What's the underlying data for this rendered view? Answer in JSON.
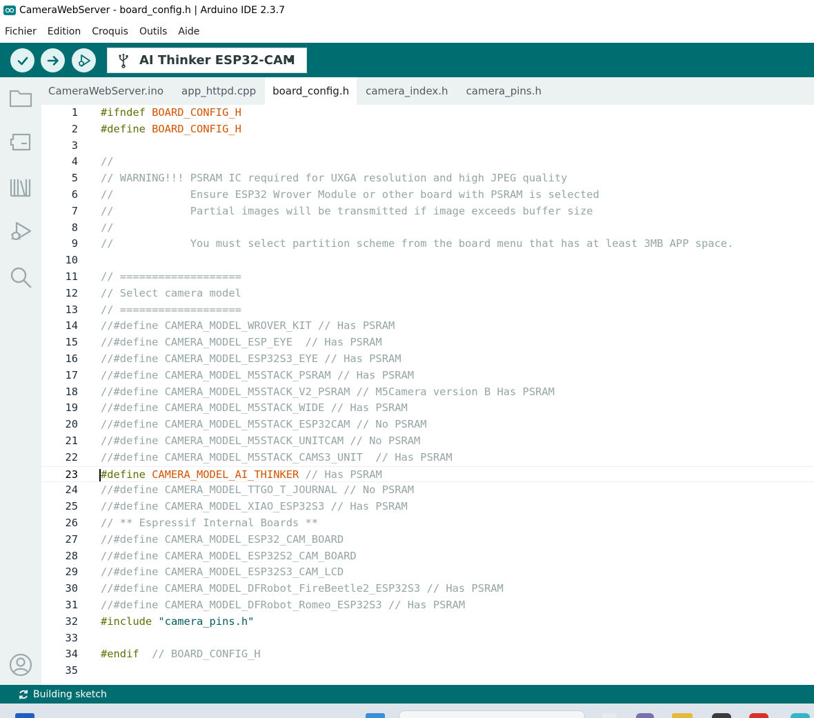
{
  "window": {
    "title": "CameraWebServer - board_config.h | Arduino IDE 2.3.7"
  },
  "menu": [
    "Fichier",
    "Edition",
    "Croquis",
    "Outils",
    "Aide"
  ],
  "toolbar": {
    "board": "AI Thinker ESP32-CAM"
  },
  "tabs": [
    {
      "label": "CameraWebServer.ino",
      "active": false
    },
    {
      "label": "app_httpd.cpp",
      "active": false
    },
    {
      "label": "board_config.h",
      "active": true
    },
    {
      "label": "camera_index.h",
      "active": false
    },
    {
      "label": "camera_pins.h",
      "active": false
    }
  ],
  "editor": {
    "current_line": 23,
    "lines": [
      [
        [
          "directive",
          "#ifndef "
        ],
        [
          "macro",
          "BOARD_CONFIG_H"
        ]
      ],
      [
        [
          "directive",
          "#define "
        ],
        [
          "macro",
          "BOARD_CONFIG_H"
        ]
      ],
      [],
      [
        [
          "comment",
          "//"
        ]
      ],
      [
        [
          "comment",
          "// WARNING!!! PSRAM IC required for UXGA resolution and high JPEG quality"
        ]
      ],
      [
        [
          "comment",
          "//            Ensure ESP32 Wrover Module or other board with PSRAM is selected"
        ]
      ],
      [
        [
          "comment",
          "//            Partial images will be transmitted if image exceeds buffer size"
        ]
      ],
      [
        [
          "comment",
          "//"
        ]
      ],
      [
        [
          "comment",
          "//            You must select partition scheme from the board menu that has at least 3MB APP space."
        ]
      ],
      [],
      [
        [
          "comment",
          "// ==================="
        ]
      ],
      [
        [
          "comment",
          "// Select camera model"
        ]
      ],
      [
        [
          "comment",
          "// ==================="
        ]
      ],
      [
        [
          "comment",
          "//#define CAMERA_MODEL_WROVER_KIT // Has PSRAM"
        ]
      ],
      [
        [
          "comment",
          "//#define CAMERA_MODEL_ESP_EYE  // Has PSRAM"
        ]
      ],
      [
        [
          "comment",
          "//#define CAMERA_MODEL_ESP32S3_EYE // Has PSRAM"
        ]
      ],
      [
        [
          "comment",
          "//#define CAMERA_MODEL_M5STACK_PSRAM // Has PSRAM"
        ]
      ],
      [
        [
          "comment",
          "//#define CAMERA_MODEL_M5STACK_V2_PSRAM // M5Camera version B Has PSRAM"
        ]
      ],
      [
        [
          "comment",
          "//#define CAMERA_MODEL_M5STACK_WIDE // Has PSRAM"
        ]
      ],
      [
        [
          "comment",
          "//#define CAMERA_MODEL_M5STACK_ESP32CAM // No PSRAM"
        ]
      ],
      [
        [
          "comment",
          "//#define CAMERA_MODEL_M5STACK_UNITCAM // No PSRAM"
        ]
      ],
      [
        [
          "comment",
          "//#define CAMERA_MODEL_M5STACK_CAMS3_UNIT  // Has PSRAM"
        ]
      ],
      [
        [
          "directive",
          "#define "
        ],
        [
          "macro",
          "CAMERA_MODEL_AI_THINKER"
        ],
        [
          "comment",
          " // Has PSRAM"
        ]
      ],
      [
        [
          "comment",
          "//#define CAMERA_MODEL_TTGO_T_JOURNAL // No PSRAM"
        ]
      ],
      [
        [
          "comment",
          "//#define CAMERA_MODEL_XIAO_ESP32S3 // Has PSRAM"
        ]
      ],
      [
        [
          "comment",
          "// ** Espressif Internal Boards **"
        ]
      ],
      [
        [
          "comment",
          "//#define CAMERA_MODEL_ESP32_CAM_BOARD"
        ]
      ],
      [
        [
          "comment",
          "//#define CAMERA_MODEL_ESP32S2_CAM_BOARD"
        ]
      ],
      [
        [
          "comment",
          "//#define CAMERA_MODEL_ESP32S3_CAM_LCD"
        ]
      ],
      [
        [
          "comment",
          "//#define CAMERA_MODEL_DFRobot_FireBeetle2_ESP32S3 // Has PSRAM"
        ]
      ],
      [
        [
          "comment",
          "//#define CAMERA_MODEL_DFRobot_Romeo_ESP32S3 // Has PSRAM"
        ]
      ],
      [
        [
          "directive",
          "#include "
        ],
        [
          "string",
          "\"camera_pins.h\""
        ]
      ],
      [],
      [
        [
          "directive",
          "#endif "
        ],
        [
          "comment",
          " // BOARD_CONFIG_H"
        ]
      ],
      []
    ]
  },
  "status": {
    "text": "Building sketch"
  },
  "colors": {
    "teal": "#006d70",
    "directive": "#5e6d03",
    "macro": "#d35400",
    "comment": "#95a5a6",
    "string": "#005c5f"
  },
  "icons": {
    "verify": "check-icon",
    "upload": "arrow-right-icon",
    "debug": "debug-icon",
    "usb": "usb-icon",
    "sidebar": [
      "folder-icon",
      "board-manager-icon",
      "library-icon",
      "debug-icon",
      "search-icon",
      "account-icon"
    ],
    "status": "spinner-icon"
  }
}
